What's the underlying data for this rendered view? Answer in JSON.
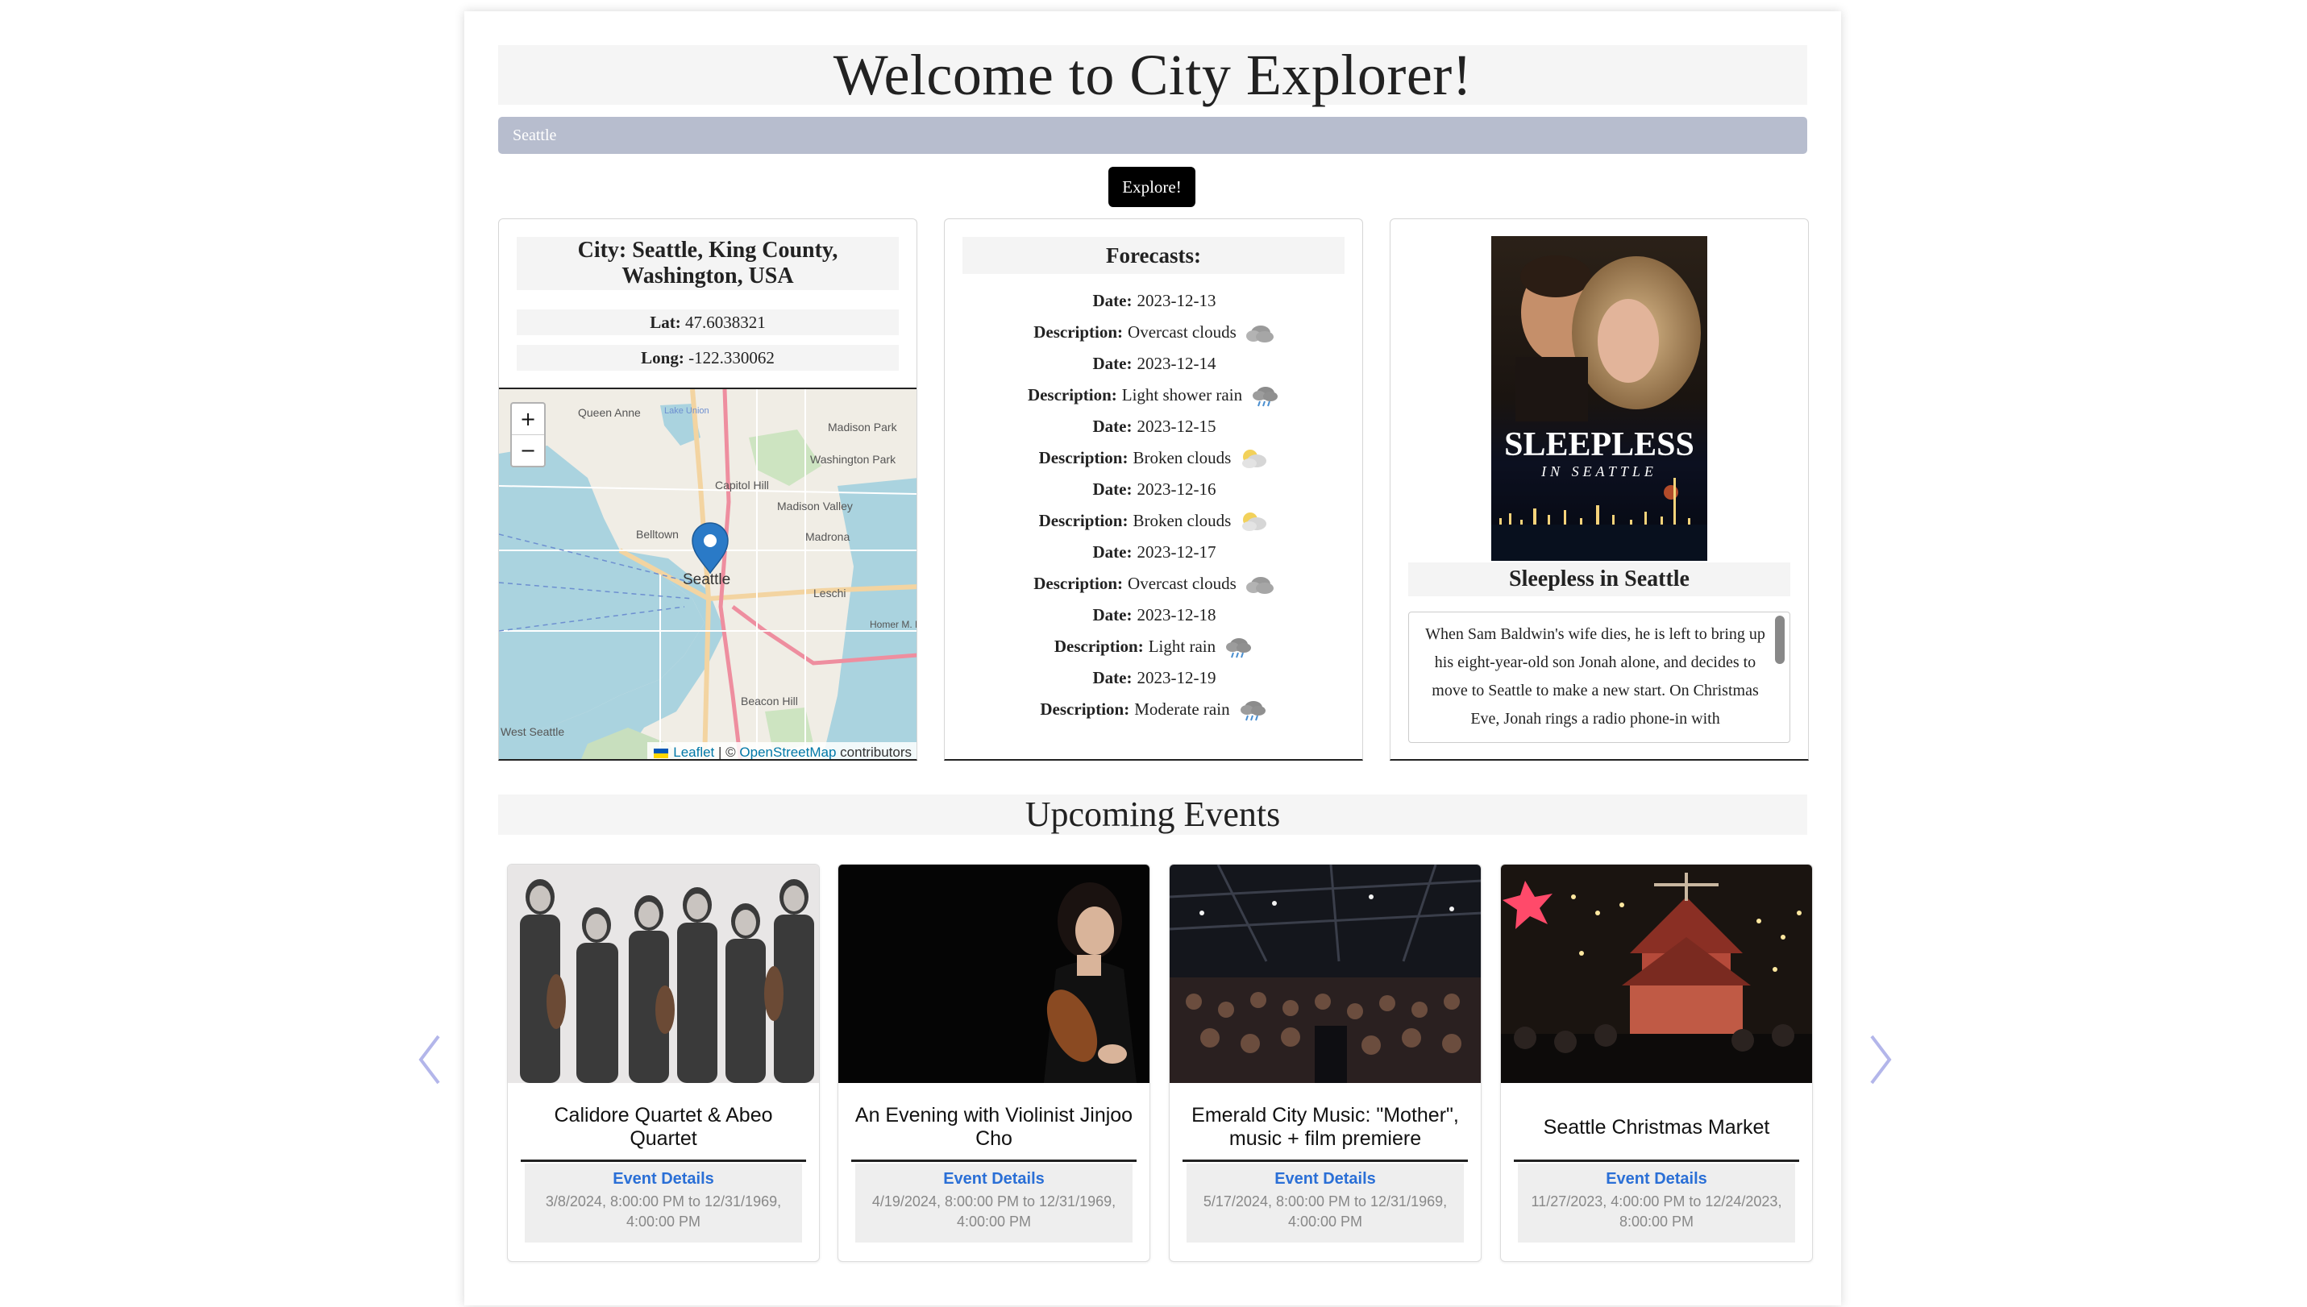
{
  "header": {
    "title": "Welcome to City Explorer!"
  },
  "search": {
    "value": "Seattle",
    "button_label": "Explore!"
  },
  "city": {
    "name": "City: Seattle, King County, Washington, USA",
    "lat_label": "Lat:",
    "lat_value": "47.6038321",
    "long_label": "Long:",
    "long_value": "-122.330062",
    "map": {
      "zoom_in": "+",
      "zoom_out": "−",
      "attribution_leaflet": "Leaflet",
      "attribution_sep": "| ©",
      "attribution_osm": "OpenStreetMap",
      "attribution_suffix": "contributors",
      "labels": {
        "queen_anne": "Queen Anne",
        "lake_union": "Lake Union",
        "madison_park": "Madison Park",
        "washington_park": "Washington Park",
        "capitol_hill": "Capitol Hill",
        "madison_valley": "Madison Valley",
        "belltown": "Belltown",
        "madrona": "Madrona",
        "seattle": "Seattle",
        "leschi": "Leschi",
        "homer_bridge": "Homer M. Hadley Memorial Bridge",
        "beacon_hill": "Beacon Hill",
        "west_seattle": "West Seattle"
      }
    }
  },
  "forecast": {
    "title": "Forecasts:",
    "date_label": "Date:",
    "desc_label": "Description:",
    "items": [
      {
        "date": "2023-12-13",
        "description": "Overcast clouds",
        "icon": "cloud-icon"
      },
      {
        "date": "2023-12-14",
        "description": "Light shower rain",
        "icon": "rain-icon"
      },
      {
        "date": "2023-12-15",
        "description": "Broken clouds",
        "icon": "sun-cloud-icon"
      },
      {
        "date": "2023-12-16",
        "description": "Broken clouds",
        "icon": "sun-cloud-icon"
      },
      {
        "date": "2023-12-17",
        "description": "Overcast clouds",
        "icon": "cloud-icon"
      },
      {
        "date": "2023-12-18",
        "description": "Light rain",
        "icon": "rain-icon"
      },
      {
        "date": "2023-12-19",
        "description": "Moderate rain",
        "icon": "rain-icon"
      }
    ]
  },
  "movie": {
    "poster_text_1": "SLEEPLESS",
    "poster_text_2": "IN SEATTLE",
    "title": "Sleepless in Seattle",
    "overview": "When Sam Baldwin's wife dies, he is left to bring up his eight-year-old son Jonah alone, and decides to move to Seattle to make a new start. On Christmas Eve, Jonah rings a radio phone-in with"
  },
  "events": {
    "title": "Upcoming Events",
    "details_label": "Event Details",
    "items": [
      {
        "name": "Calidore Quartet & Abeo Quartet",
        "dates": "3/8/2024, 8:00:00 PM to 12/31/1969, 4:00:00 PM"
      },
      {
        "name": "An Evening with Violinist Jinjoo Cho",
        "dates": "4/19/2024, 8:00:00 PM to 12/31/1969, 4:00:00 PM"
      },
      {
        "name": "Emerald City Music: \"Mother\", music + film premiere",
        "dates": "5/17/2024, 8:00:00 PM to 12/31/1969, 4:00:00 PM"
      },
      {
        "name": "Seattle Christmas Market",
        "dates": "11/27/2023, 4:00:00 PM to 12/24/2023, 8:00:00 PM"
      }
    ]
  },
  "colors": {
    "search_bg": "#b7bdce",
    "link": "#2a6fd6",
    "marker": "#2a7ac7",
    "carousel_arrow": "#b3b6ea"
  }
}
